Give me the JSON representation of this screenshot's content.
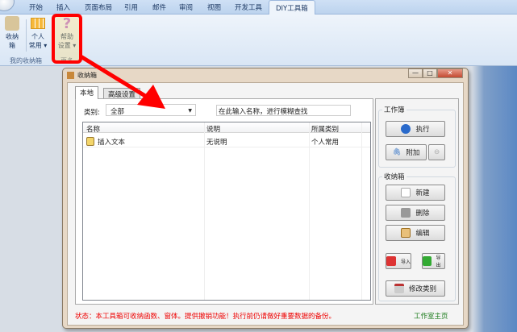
{
  "ribbon": {
    "tabs": [
      "开始",
      "插入",
      "页面布局",
      "引用",
      "邮件",
      "审阅",
      "视图",
      "开发工具",
      "DIY工具箱"
    ],
    "buttons": {
      "collect": "收纳\n箱",
      "personal": "个人\n常用",
      "personal2": "常用",
      "help1": "帮助",
      "help2": "设置"
    },
    "groups": {
      "g1": "我的收纳箱",
      "g2": "更多"
    }
  },
  "dialog": {
    "title": "收纳箱",
    "tabs": [
      "本地",
      "高级设置"
    ],
    "category_label": "类别:",
    "category_value": "全部",
    "search_placeholder": "在此输入名称，进行模糊查找",
    "columns": [
      "名称",
      "说明",
      "所属类别"
    ],
    "rows": [
      {
        "name": "插入文本",
        "desc": "无说明",
        "cat": "个人常用"
      }
    ],
    "work": {
      "legend": "工作簿",
      "execute": "执行",
      "attach": "附加"
    },
    "box": {
      "legend": "收纳箱",
      "new": "新建",
      "delete": "删除",
      "edit": "编辑",
      "import": "导入",
      "export": "导出",
      "modify": "修改类别"
    },
    "status": "状态：本工具箱可收纳函数、窗体。提供撤销功能！执行前仍请做好重要数据的备份。",
    "home_link": "工作室主页"
  },
  "colors": {
    "accent": "#ff0000",
    "link": "#1a7a1a"
  }
}
